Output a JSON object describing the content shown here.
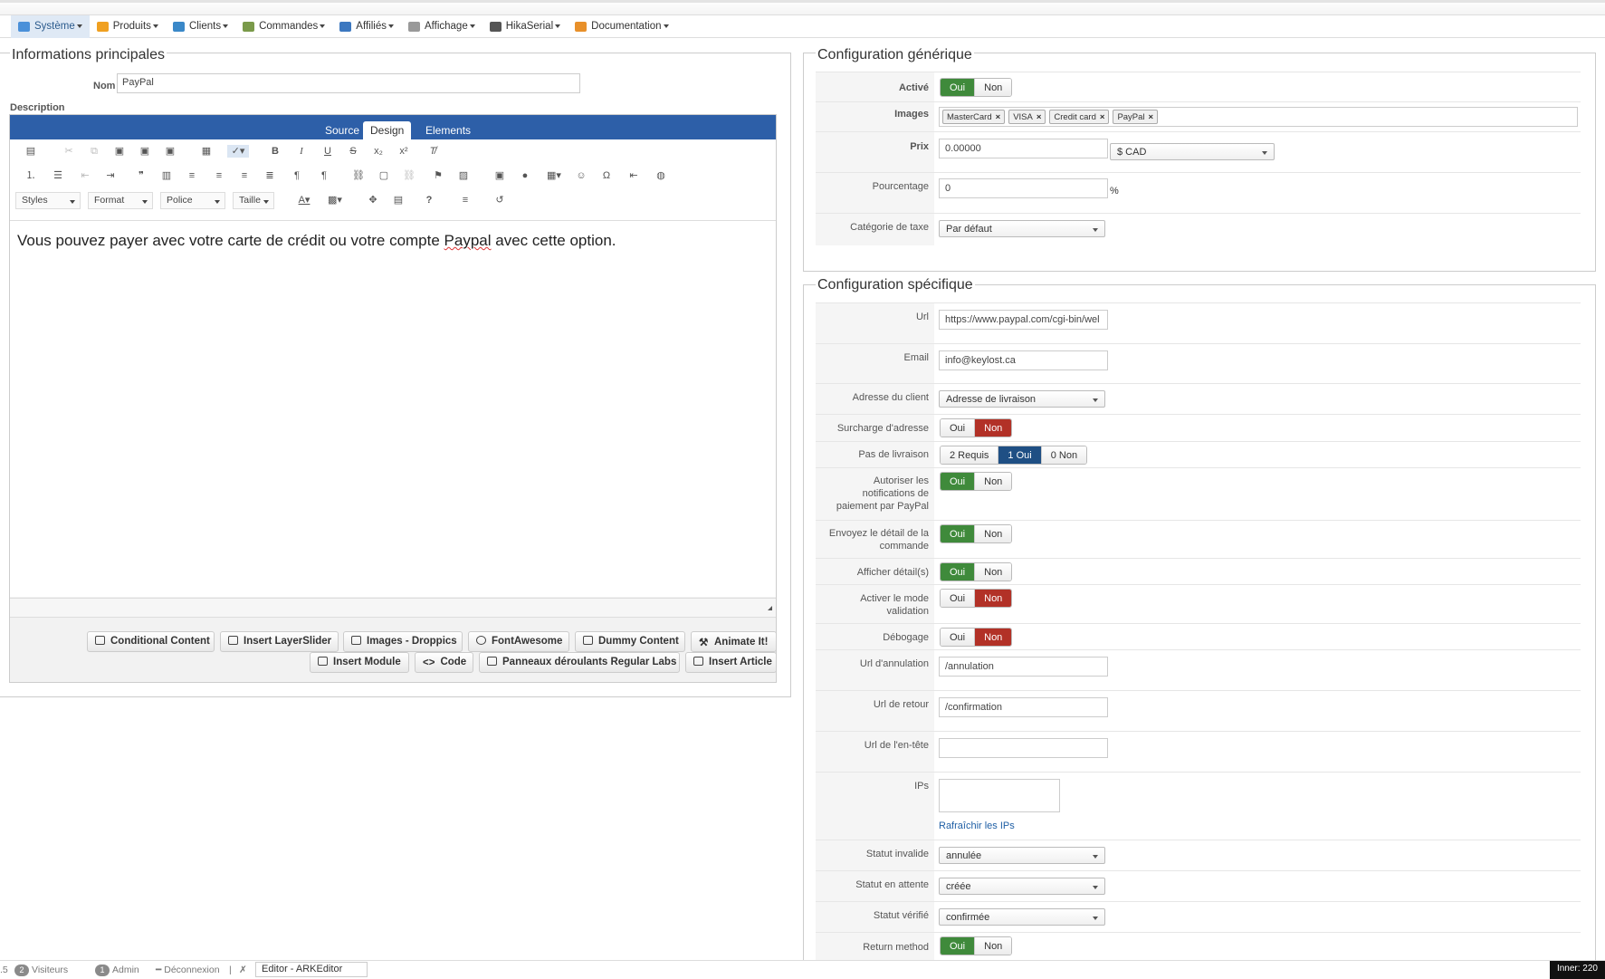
{
  "menu": [
    {
      "label": "Système",
      "icon": "tools-icon",
      "color": "#4a90d9",
      "active": true
    },
    {
      "label": "Produits",
      "icon": "box-icon",
      "color": "#f0a020"
    },
    {
      "label": "Clients",
      "icon": "users-icon",
      "color": "#3a88c8"
    },
    {
      "label": "Commandes",
      "icon": "cart-icon",
      "color": "#7a9a4a"
    },
    {
      "label": "Affiliés",
      "icon": "chart-icon",
      "color": "#3c78c0"
    },
    {
      "label": "Affichage",
      "icon": "display-icon",
      "color": "#999999"
    },
    {
      "label": "HikaSerial",
      "icon": "serial-icon",
      "color": "#555555"
    },
    {
      "label": "Documentation",
      "icon": "help-icon",
      "color": "#e8902a"
    }
  ],
  "main_info": {
    "legend": "Informations principales",
    "name_label": "Nom",
    "name_value": "PayPal",
    "description_label": "Description"
  },
  "editor": {
    "tabs": [
      "Source",
      "Design",
      "Elements"
    ],
    "active_tab": "Design",
    "dropdowns": [
      "Styles",
      "Format",
      "Police",
      "Taille"
    ],
    "content_before": "Vous pouvez payer avec votre carte de crédit ou votre compte ",
    "content_spell": "Paypal",
    "content_after": " avec cette option.",
    "buttons_row1": [
      "Conditional Content",
      "Insert LayerSlider",
      "Images - Droppics",
      "FontAwesome",
      "Dummy Content",
      "Animate It!"
    ],
    "buttons_row2": [
      "Insert Module",
      "Code",
      "Panneaux déroulants Regular Labs",
      "Insert Article"
    ]
  },
  "generic": {
    "legend": "Configuration générique",
    "active_label": "Activé",
    "images_label": "Images",
    "images": [
      "MasterCard",
      "VISA",
      "Credit card",
      "PayPal"
    ],
    "price_label": "Prix",
    "price_value": "0.00000",
    "currency": "$ CAD",
    "percent_label": "Pourcentage",
    "percent_value": "0",
    "percent_sign": "%",
    "tax_label": "Catégorie de taxe",
    "tax_value": "Par défaut"
  },
  "specific": {
    "legend": "Configuration spécifique",
    "url_label": "Url",
    "url_value": "https://www.paypal.com/cgi-bin/wel",
    "email_label": "Email",
    "email_value": "info@keylost.ca",
    "address_label": "Adresse du client",
    "address_value": "Adresse de livraison",
    "override_label": "Surcharge d'adresse",
    "shipping_label": "Pas de livraison",
    "shipping_options": [
      "2 Requis",
      "1 Oui",
      "0 Non"
    ],
    "notif_label": "Autoriser les notifications de paiement par PayPal",
    "details_label": "Envoyez le détail de la commande",
    "show_details_label": "Afficher détail(s)",
    "validation_label": "Activer le mode validation",
    "debug_label": "Débogage",
    "cancel_url_label": "Url d'annulation",
    "cancel_url_value": "/annulation",
    "return_url_label": "Url de retour",
    "return_url_value": "/confirmation",
    "header_url_label": "Url de l'en-tête",
    "header_url_value": "",
    "ips_label": "IPs",
    "refresh_ips": "Rafraîchir les IPs",
    "invalid_label": "Statut invalide",
    "invalid_value": "annulée",
    "pending_label": "Statut en attente",
    "pending_value": "créée",
    "verified_label": "Statut vérifié",
    "verified_value": "confirmée",
    "return_method_label": "Return method"
  },
  "toggle": {
    "yes": "Oui",
    "no": "Non"
  },
  "statusbar": {
    "version_fragment": ".5",
    "visitors_count": "2",
    "visitors_label": "Visiteurs",
    "admin_count": "1",
    "admin_label": "Admin",
    "logout_label": "Déconnexion",
    "editor_select": "Editor - ARKEditor",
    "inner_label": "Inner: 220"
  }
}
